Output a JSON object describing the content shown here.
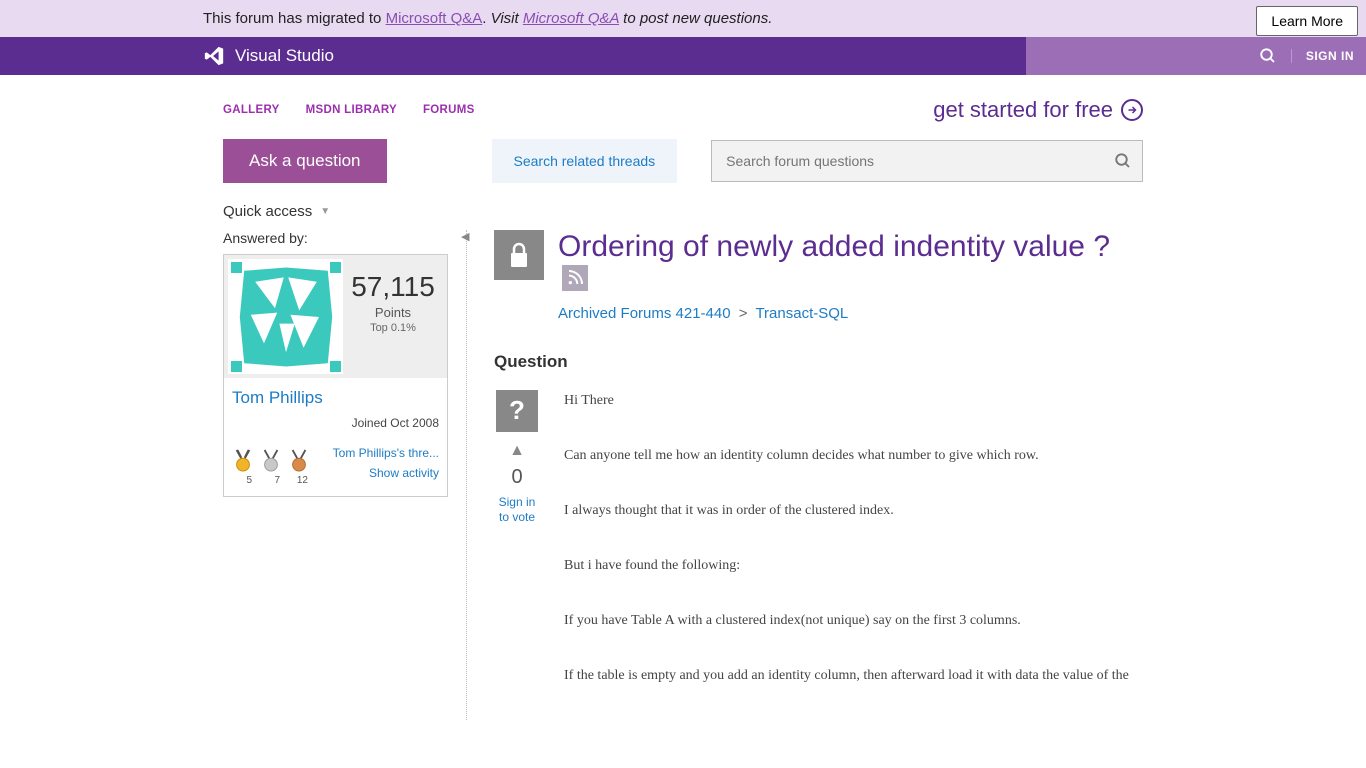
{
  "banner": {
    "text_prefix": "This forum has migrated to ",
    "link1": "Microsoft Q&A",
    "text_mid": ". ",
    "visit_prefix": "Visit ",
    "link2": "Microsoft Q&A",
    "visit_suffix": " to post new questions.",
    "learn_more": "Learn More"
  },
  "topbar": {
    "brand": "Visual Studio",
    "sign_in": "SIGN IN"
  },
  "nav": {
    "gallery": "GALLERY",
    "msdn": "MSDN LIBRARY",
    "forums": "FORUMS",
    "get_started": "get started for free"
  },
  "actions": {
    "ask": "Ask a question",
    "search_related": "Search related threads",
    "search_placeholder": "Search forum questions"
  },
  "quick_access": "Quick access",
  "sidebar": {
    "answered_by": "Answered by:",
    "points": "57,115",
    "points_label": "Points",
    "top_pct": "Top 0.1%",
    "name": "Tom Phillips",
    "joined": "Joined Oct 2008",
    "medals": {
      "gold": "5",
      "silver": "7",
      "bronze": "12"
    },
    "thread_link": "Tom Phillips's thre...",
    "activity_link": "Show activity"
  },
  "thread": {
    "title": "Ordering of newly added indentity value ?",
    "breadcrumb": {
      "forum": "Archived Forums 421-440",
      "sep": ">",
      "topic": "Transact-SQL"
    },
    "question_label": "Question",
    "vote": {
      "count": "0",
      "sign_in": "Sign in to vote"
    },
    "body": {
      "p1": "Hi There",
      "p2": "Can anyone tell me how an identity column decides what number to give which row.",
      "p3": "I always thought that it was in order of the clustered index.",
      "p4": "But i have found the following:",
      "p5": "If you have Table A with a clustered index(not unique) say on the first 3 columns.",
      "p6": "If the table is empty and you add an identity column, then afterward load it with data the value of the"
    }
  }
}
